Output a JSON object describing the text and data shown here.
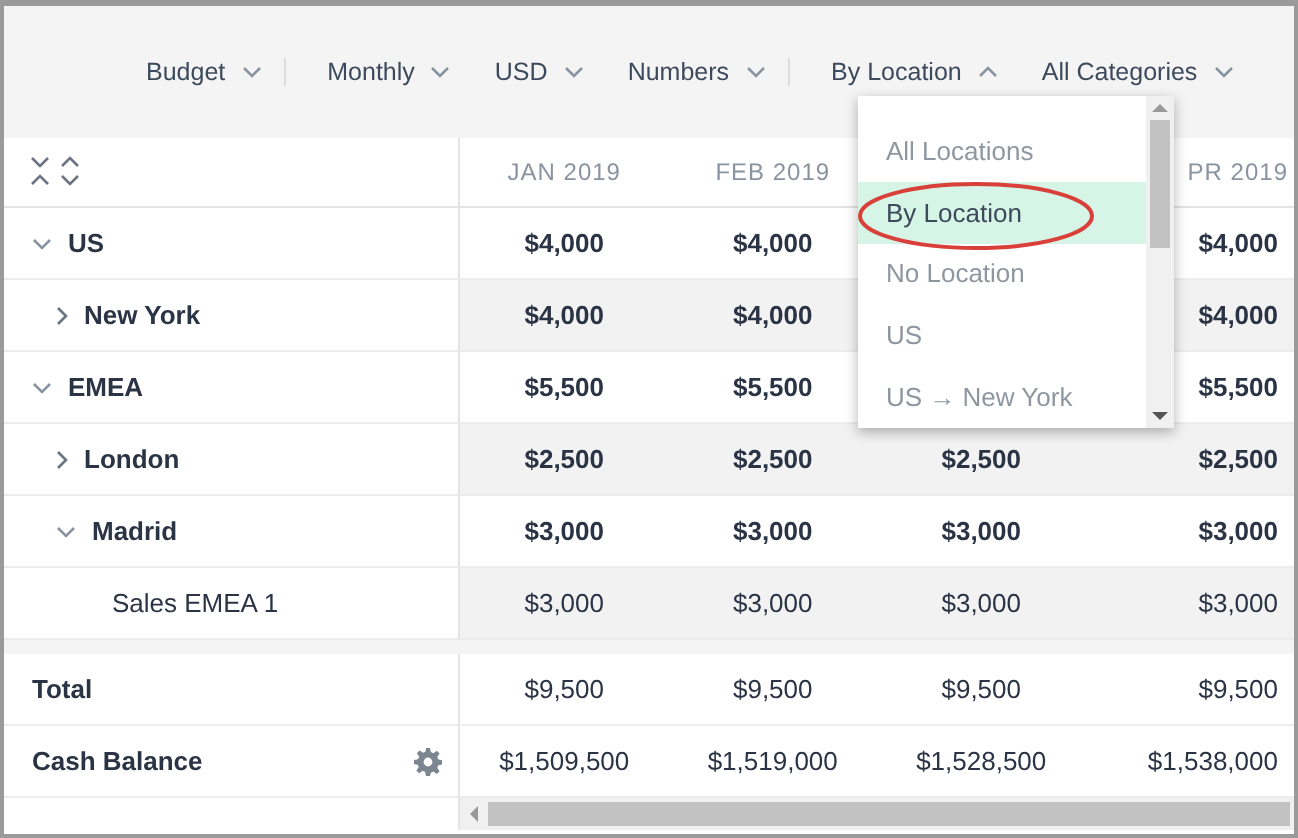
{
  "toolbar": [
    {
      "label": "Budget",
      "open": false,
      "divider_after": true
    },
    {
      "label": "Monthly",
      "open": false,
      "divider_after": false
    },
    {
      "label": "USD",
      "open": false,
      "divider_after": false
    },
    {
      "label": "Numbers",
      "open": false,
      "divider_after": true
    },
    {
      "label": "By Location",
      "open": true,
      "divider_after": false
    },
    {
      "label": "All Categories",
      "open": false,
      "divider_after": false
    }
  ],
  "dropdown": {
    "items": [
      {
        "label": "All Locations",
        "selected": false
      },
      {
        "label": "By Location",
        "selected": true
      },
      {
        "label": "No Location",
        "selected": false
      },
      {
        "label": "US",
        "selected": false
      },
      {
        "label": "US → New York",
        "selected": false
      }
    ]
  },
  "table": {
    "columns": [
      "JAN 2019",
      "FEB 2019",
      "PR 2019"
    ],
    "rows": [
      {
        "label": "US",
        "expanded": true,
        "values": [
          "$4,000",
          "$4,000",
          "$4,000"
        ],
        "children": [
          {
            "label": "New York",
            "expanded": false,
            "values": [
              "$4,000",
              "$4,000",
              "$4,000"
            ]
          }
        ]
      },
      {
        "label": "EMEA",
        "expanded": true,
        "values": [
          "$5,500",
          "$5,500",
          "$5,500"
        ],
        "children": [
          {
            "label": "London",
            "expanded": false,
            "values": [
              "$2,500",
              "$2,500",
              "$2,500",
              "$2,500"
            ]
          },
          {
            "label": "Madrid",
            "expanded": true,
            "values": [
              "$3,000",
              "$3,000",
              "$3,000",
              "$3,000"
            ],
            "children": [
              {
                "label": "Sales EMEA 1",
                "values": [
                  "$3,000",
                  "$3,000",
                  "$3,000",
                  "$3,000"
                ]
              }
            ]
          }
        ]
      }
    ]
  },
  "summary": [
    {
      "label": "Total",
      "kind": "plain",
      "values": [
        "$9,500",
        "$9,500",
        "$9,500",
        "$9,500"
      ]
    },
    {
      "label": "Cash Balance",
      "kind": "settings",
      "values": [
        "$1,509,500",
        "$1,519,000",
        "$1,528,500",
        "$1,538,000"
      ]
    }
  ]
}
